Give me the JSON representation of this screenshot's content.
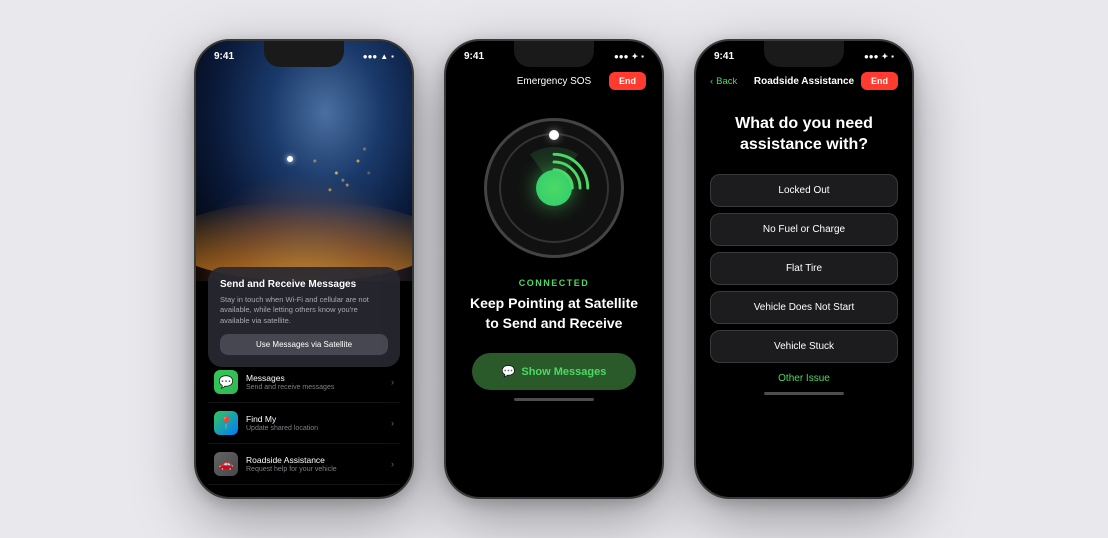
{
  "phone1": {
    "status": {
      "time": "9:41",
      "signal": "●●●",
      "wifi": "WiFi",
      "battery": "100"
    },
    "card": {
      "title": "Send and Receive Messages",
      "description": "Stay in touch when Wi-Fi and cellular are not available, while letting others know you're available via satellite.",
      "button": "Use Messages via Satellite"
    },
    "list": [
      {
        "icon": "messages",
        "title": "Messages",
        "subtitle": "Send and receive messages"
      },
      {
        "icon": "findmy",
        "title": "Find My",
        "subtitle": "Update shared location"
      },
      {
        "icon": "roadside",
        "title": "Roadside Assistance",
        "subtitle": "Request help for your vehicle"
      }
    ]
  },
  "phone2": {
    "status": {
      "time": "9:41",
      "signal": "●●●",
      "wifi": "WiFi",
      "battery": "100"
    },
    "header": {
      "title": "Emergency SOS",
      "end_button": "End"
    },
    "compass": {
      "connected_label": "CONNECTED",
      "instruction": "Keep Pointing at Satellite\nto Send and Receive"
    },
    "show_messages_button": "Show Messages"
  },
  "phone3": {
    "status": {
      "time": "9:41",
      "signal": "●●●",
      "wifi": "WiFi",
      "battery": "100"
    },
    "header": {
      "back_label": "Back",
      "title": "Roadside Assistance",
      "end_button": "End"
    },
    "question": "What do you need assistance with?",
    "options": [
      "Locked Out",
      "No Fuel or Charge",
      "Flat Tire",
      "Vehicle Does Not Start",
      "Vehicle Stuck"
    ],
    "other_issue": "Other Issue"
  }
}
